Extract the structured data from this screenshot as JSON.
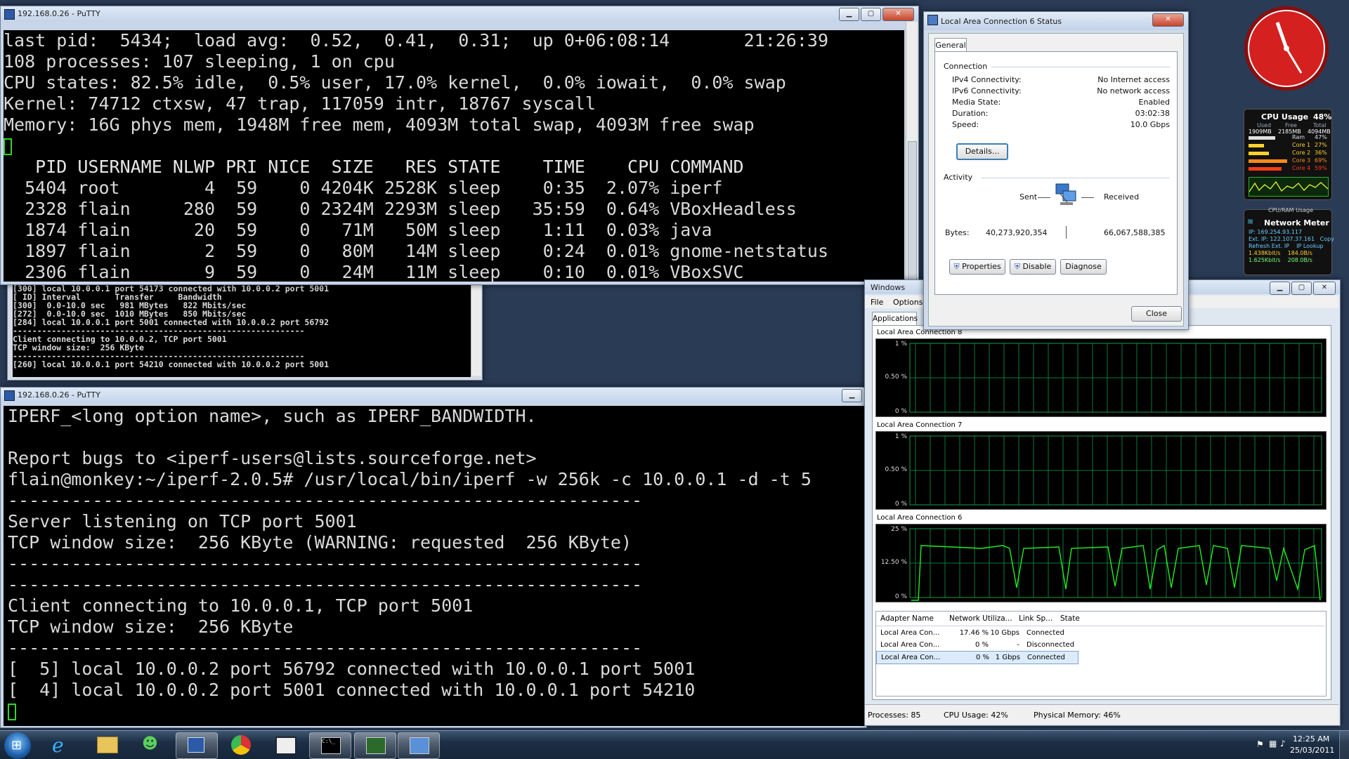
{
  "putty_top": {
    "title": "192.168.0.26 - PuTTY",
    "lines": [
      "last pid:  5434;  load avg:  0.52,  0.41,  0.31;  up 0+06:08:14       21:26:39",
      "108 processes: 107 sleeping, 1 on cpu",
      "CPU states: 82.5% idle,  0.5% user, 17.0% kernel,  0.0% iowait,  0.0% swap",
      "Kernel: 74712 ctxsw, 47 trap, 117059 intr, 18767 syscall",
      "Memory: 16G phys mem, 1948M free mem, 4093M total swap, 4093M free swap"
    ],
    "header": "   PID USERNAME NLWP PRI NICE  SIZE   RES STATE    TIME    CPU COMMAND",
    "procs": [
      "  5404 root        4  59    0 4204K 2528K sleep    0:35  2.07% iperf",
      "  2328 flain     280  59    0 2324M 2293M sleep   35:59  0.64% VBoxHeadless",
      "  1874 flain      20  59    0   71M   50M sleep    1:11  0.03% java",
      "  1897 flain       2  59    0   80M   14M sleep    0:24  0.01% gnome-netstatus",
      "  2306 flain       9  59    0   24M   11M sleep    0:10  0.01% VBoxSVC"
    ]
  },
  "cmd_bg": {
    "lines": [
      "[300] local 10.0.0.1 port 54173 connected with 10.0.0.2 port 5001",
      "[ ID] Interval       Transfer     Bandwidth",
      "[300]  0.0-10.0 sec   981 MBytes   822 Mbits/sec",
      "[272]  0.0-10.0 sec  1010 MBytes   850 Mbits/sec",
      "[284] local 10.0.0.1 port 5001 connected with 10.0.0.2 port 56792",
      "------------------------------------------------------------",
      "Client connecting to 10.0.0.2, TCP port 5001",
      "TCP window size:  256 KByte",
      "------------------------------------------------------------",
      "[260] local 10.0.0.1 port 54210 connected with 10.0.0.2 port 5001"
    ]
  },
  "putty_bottom": {
    "title": "192.168.0.26 - PuTTY",
    "lines": [
      "IPERF_<long option name>, such as IPERF_BANDWIDTH.",
      "",
      "Report bugs to <iperf-users@lists.sourceforge.net>",
      "flain@monkey:~/iperf-2.0.5# /usr/local/bin/iperf -w 256k -c 10.0.0.1 -d -t 5",
      "------------------------------------------------------------",
      "Server listening on TCP port 5001",
      "TCP window size:  256 KByte (WARNING: requested  256 KByte)",
      "------------------------------------------------------------",
      "------------------------------------------------------------",
      "Client connecting to 10.0.0.1, TCP port 5001",
      "TCP window size:  256 KByte",
      "------------------------------------------------------------",
      "[  5] local 10.0.0.2 port 56792 connected with 10.0.0.1 port 5001",
      "[  4] local 10.0.0.2 port 5001 connected with 10.0.0.1 port 54210"
    ]
  },
  "status_dialog": {
    "title": "Local Area Connection 6 Status",
    "tab": "General",
    "connection_label": "Connection",
    "rows": [
      {
        "k": "IPv4 Connectivity:",
        "v": "No Internet access"
      },
      {
        "k": "IPv6 Connectivity:",
        "v": "No network access"
      },
      {
        "k": "Media State:",
        "v": "Enabled"
      },
      {
        "k": "Duration:",
        "v": "03:02:38"
      },
      {
        "k": "Speed:",
        "v": "10.0 Gbps"
      }
    ],
    "details_btn": "Details...",
    "activity_label": "Activity",
    "sent_label": "Sent",
    "received_label": "Received",
    "bytes_label": "Bytes:",
    "bytes_sent": "40,273,920,354",
    "bytes_received": "66,067,588,385",
    "properties_btn": "Properties",
    "disable_btn": "Disable",
    "diagnose_btn": "Diagnose",
    "close_btn": "Close"
  },
  "taskman": {
    "title": "Windows",
    "menu": [
      "File",
      "Options"
    ],
    "tab": "Applications",
    "graphs": [
      {
        "name": "Local Area Connection 8",
        "top": "1 %",
        "mid": "0.50 %",
        "bot": "0 %"
      },
      {
        "name": "Local Area Connection 7",
        "top": "1 %",
        "mid": "0.50 %",
        "bot": "0 %"
      },
      {
        "name": "Local Area Connection 6",
        "top": "25 %",
        "mid": "12.50 %",
        "bot": "0 %"
      }
    ],
    "cols": [
      "Adapter Name",
      "Network Utiliza...",
      "Link Sp...",
      "State"
    ],
    "rows": [
      [
        "Local Area Con...",
        "17.46 %",
        "10 Gbps",
        "Connected"
      ],
      [
        "Local Area Con...",
        "0 %",
        "-",
        "Disconnected"
      ],
      [
        "Local Area Con...",
        "0 %",
        "1 Gbps",
        "Connected"
      ]
    ],
    "status": {
      "processes": "Processes: 85",
      "cpu": "CPU Usage: 42%",
      "mem": "Physical Memory: 46%"
    }
  },
  "gadgets": {
    "cpu_title": "CPU Usage",
    "cpu_pct": "48%",
    "cpu_cols": [
      "Used",
      "Free",
      "Total"
    ],
    "cpu_vals": [
      "1909MB",
      "2185MB",
      "4094MB"
    ],
    "cores": [
      {
        "name": "Ram",
        "pct": "47%",
        "level": 0.47
      },
      {
        "name": "Core 1",
        "pct": "27%",
        "level": 0.27
      },
      {
        "name": "Core 2",
        "pct": "36%",
        "level": 0.36
      },
      {
        "name": "Core 3",
        "pct": "69%",
        "level": 0.69
      },
      {
        "name": "Core 4",
        "pct": "59%",
        "level": 0.59
      }
    ],
    "ram_header": "CPU/RAM Usage",
    "net_title": "Network Meter",
    "net_lines": [
      "IP: 169.254.93.117",
      "Ext. IP: 122.107.37.161   Copy",
      "Refresh Ext. IP    IP Lookup",
      "1.438Kbit/s    184.0B/s",
      "1.625Kbit/s    208.0B/s"
    ]
  },
  "clock": {
    "time": "12:25 AM",
    "date": "25/03/2011"
  },
  "colors": {
    "graph_line": "#22ee22",
    "grid": "#0a7a3a",
    "accent": "#d21a1a"
  }
}
